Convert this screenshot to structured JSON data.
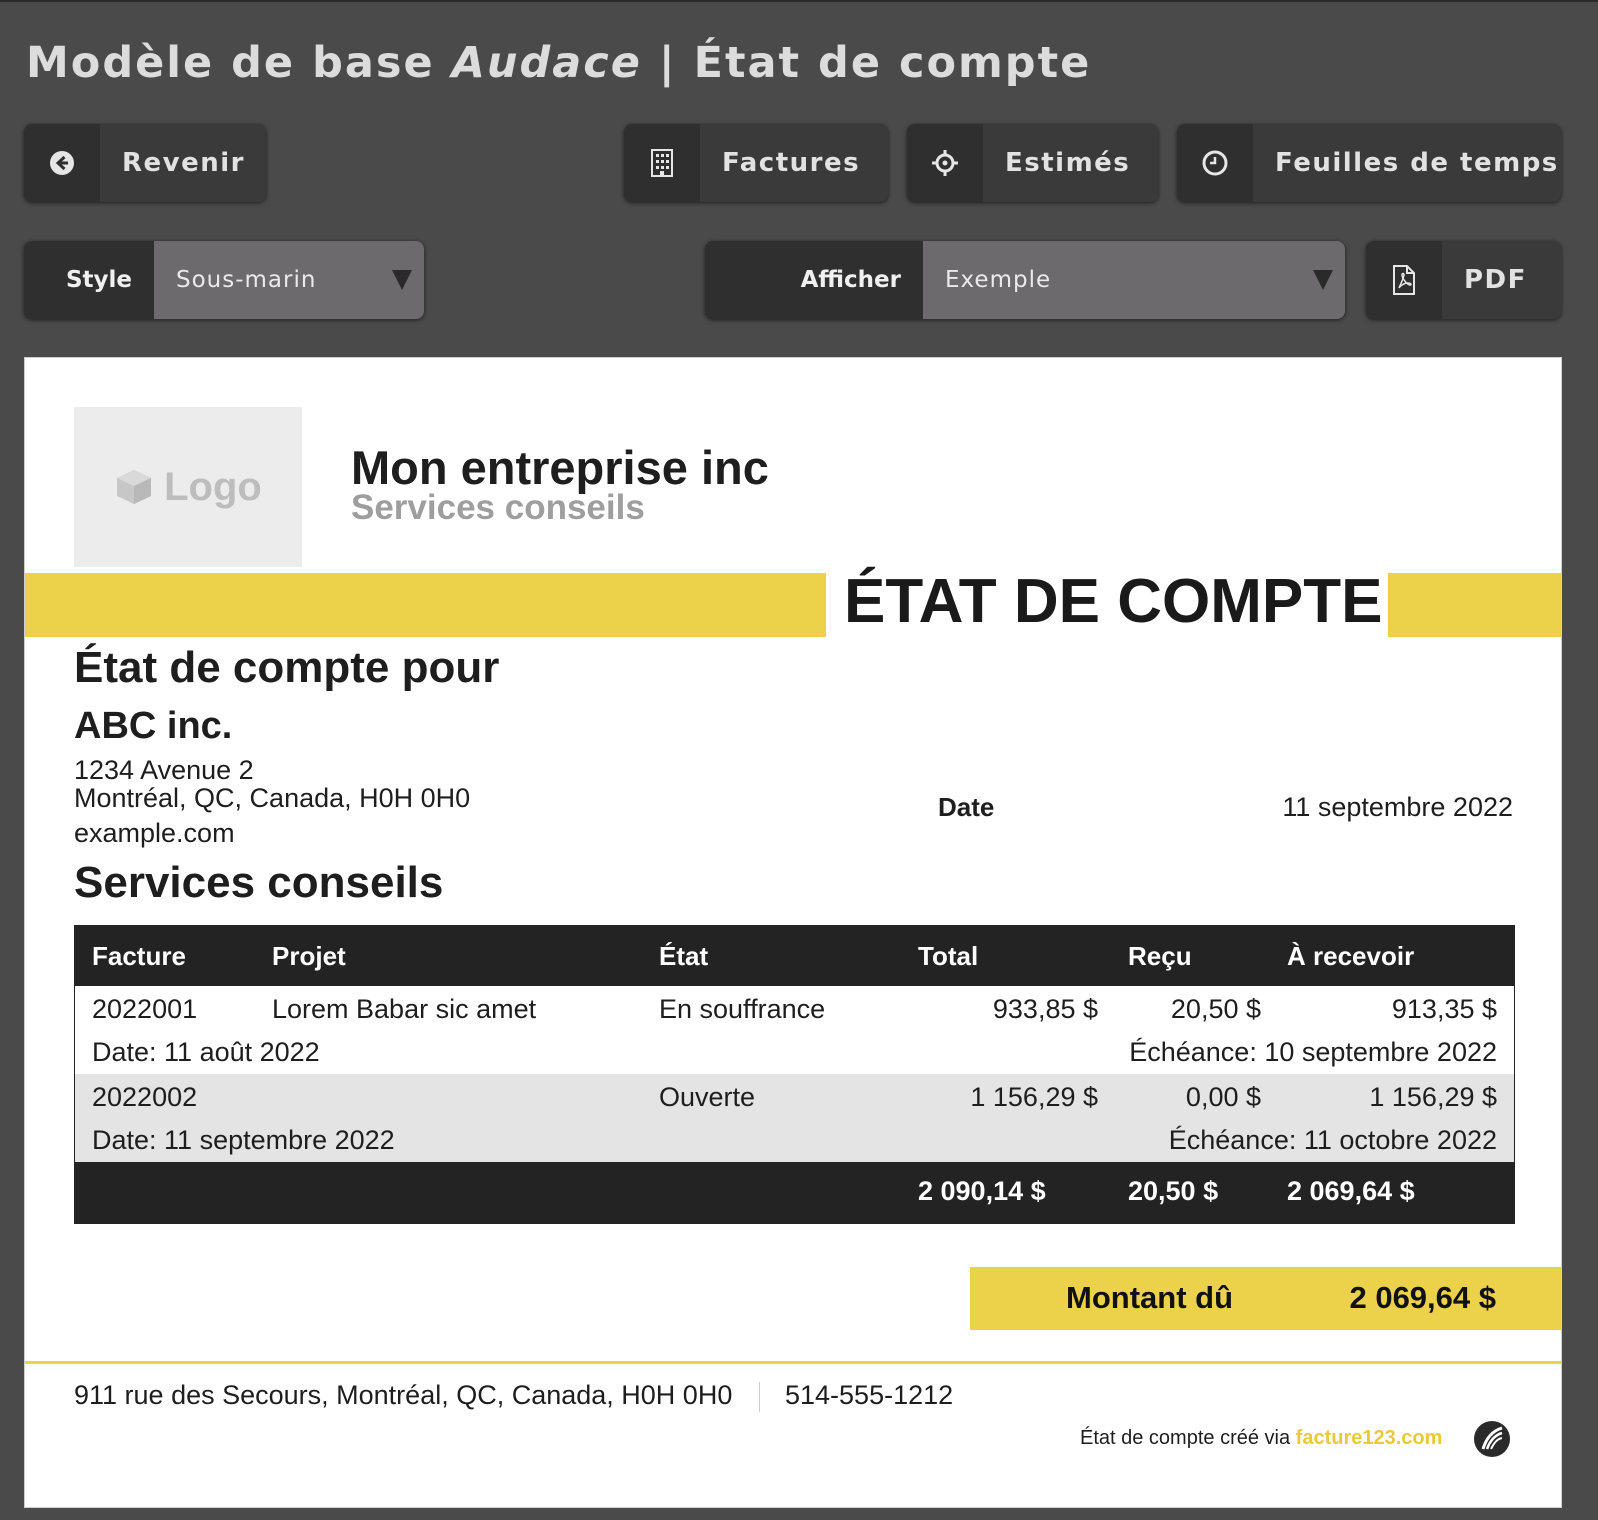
{
  "header": {
    "title_prefix": "Modèle de base ",
    "title_italic": "Audace",
    "title_suffix": " | État de compte"
  },
  "toolbar": {
    "back_label": "Revenir",
    "invoices_label": "Factures",
    "estimates_label": "Estimés",
    "timesheets_label": "Feuilles de temps",
    "pdf_label": "PDF"
  },
  "style_select": {
    "label": "Style",
    "value": "Sous-marin"
  },
  "show_select": {
    "label": "Afficher",
    "value": "Exemple"
  },
  "document": {
    "logo_text": "Logo",
    "company_name": "Mon entreprise inc",
    "company_tagline": "Services conseils",
    "title": "ÉTAT DE COMPTE",
    "for_label": "État de compte pour",
    "client_name": "ABC inc.",
    "client_address_1": "1234 Avenue 2",
    "client_address_2": "Montréal, QC, Canada, H0H 0H0",
    "client_website": "example.com",
    "date_label": "Date",
    "date_value": "11 septembre 2022",
    "section_title": "Services conseils",
    "table": {
      "headers": [
        "Facture",
        "Projet",
        "État",
        "Total",
        "Reçu",
        "À recevoir"
      ],
      "rows": [
        {
          "invoice": "2022001",
          "project": "Lorem Babar sic amet",
          "status": "En souffrance",
          "total": "933,85 $",
          "received": "20,50 $",
          "receivable": "913,35 $",
          "date": "Date: 11 août 2022",
          "due": "Échéance: 10 septembre 2022"
        },
        {
          "invoice": "2022002",
          "project": "",
          "status": "Ouverte",
          "total": "1 156,29 $",
          "received": "0,00 $",
          "receivable": "1 156,29 $",
          "date": "Date: 11 septembre 2022",
          "due": "Échéance: 11 octobre 2022"
        }
      ],
      "totals": {
        "total": "2 090,14 $",
        "received": "20,50 $",
        "receivable": "2 069,64 $"
      }
    },
    "amount_due_label": "Montant dû",
    "amount_due_value": "2 069,64 $",
    "footer_address": "911 rue des Secours, Montréal, QC, Canada, H0H 0H0",
    "footer_phone": "514-555-1212",
    "credit_text": "État de compte créé via ",
    "credit_link": "facture123.com"
  },
  "colors": {
    "background": "#4a4a4b",
    "accent_yellow": "#ecd14b",
    "table_header": "#232323",
    "row_alt": "#e4e4e4"
  },
  "icons": {
    "back": "arrow-left-circle-icon",
    "invoices": "building-icon",
    "estimates": "crosshair-icon",
    "timesheets": "clock-icon",
    "pdf": "pdf-file-icon",
    "logo": "cube-icon"
  }
}
